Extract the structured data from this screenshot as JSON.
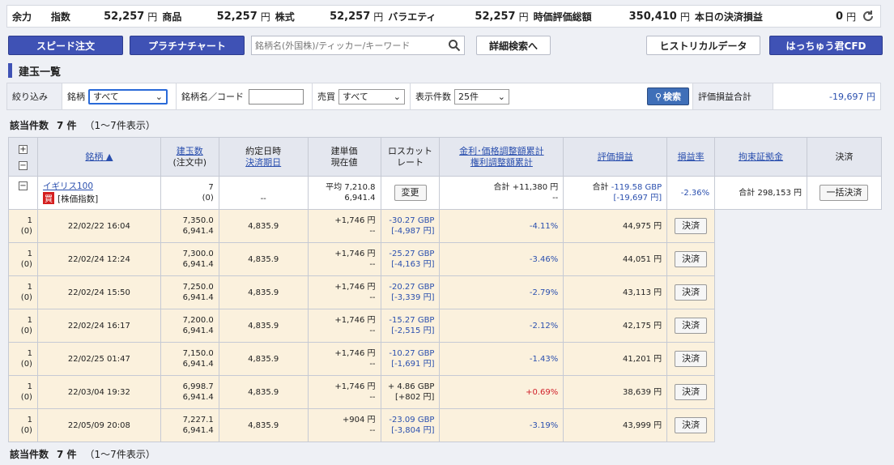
{
  "topbar": {
    "yoryoku": "余力",
    "index_label": "指数",
    "index_value": "52,257",
    "commodity_label": "商品",
    "commodity_value": "52,257",
    "stock_label": "株式",
    "stock_value": "52,257",
    "variety_label": "バラエティ",
    "variety_value": "52,257",
    "valuation_label": "時価評価総額",
    "valuation_value": "350,410",
    "settle_label": "本日の決済損益",
    "settle_value": "0",
    "yen": "円"
  },
  "buttons": {
    "speed_order": "スピード注文",
    "platinum_chart": "プラチナチャート",
    "search_placeholder": "銘柄名(外国株)/ティッカー/キーワード",
    "detail_search": "詳細検索へ",
    "historical": "ヒストリカルデータ",
    "hacchu": "はっちゅう君CFD"
  },
  "section_title": "建玉一覧",
  "filter": {
    "narrow": "絞り込み",
    "brand_label": "銘柄",
    "brand_value": "すべて",
    "name_code_label": "銘柄名／コード",
    "buysell_label": "売買",
    "buysell_value": "すべて",
    "count_label": "表示件数",
    "count_value": "25件",
    "search_btn": "検索",
    "pl_total_label": "評価損益合計",
    "pl_total_value": "-19,697 円"
  },
  "summary": {
    "label": "該当件数",
    "count": "7 件",
    "range": "（1〜7件表示）"
  },
  "headers": {
    "brand": "銘柄 ▲",
    "position_qty": "建玉数",
    "in_order": "(注文中)",
    "contract_date": "約定日時",
    "settle_date": "決済期日",
    "build_price": "建単価",
    "current_price": "現在値",
    "losscut": "ロスカット",
    "rate": "レート",
    "interest": "金利･価格調整額累計",
    "rights": "権利調整額累計",
    "valuation": "評価損益",
    "pl_rate": "損益率",
    "margin": "拘束証拠金",
    "settlement": "決済"
  },
  "main_row": {
    "brand_name": "イギリス100",
    "buy_badge": "買",
    "brand_type": "[株価指数]",
    "qty": "7",
    "qty_order": "(0)",
    "date": "--",
    "avg_label": "平均",
    "build": "7,210.8",
    "current": "6,941.4",
    "change_btn": "変更",
    "interest_label": "合計",
    "interest": "+11,380 円",
    "rights": "--",
    "val_label": "合計",
    "val_gbp": "-119.58 GBP",
    "val_jpy": "[-19,697 円]",
    "rate": "-2.36%",
    "margin_label": "合計",
    "margin": "298,153 円",
    "bulk_btn": "一括決済"
  },
  "rows": [
    {
      "qty": "1",
      "order": "(0)",
      "date": "22/02/22 16:04",
      "build": "7,350.0",
      "current": "6,941.4",
      "losscut": "4,835.9",
      "interest": "+1,746 円",
      "rights": "--",
      "gbp": "-30.27 GBP",
      "jpy": "[-4,987 円]",
      "rate": "-4.11%",
      "margin": "44,975 円",
      "btn": "決済",
      "sign": "neg"
    },
    {
      "qty": "1",
      "order": "(0)",
      "date": "22/02/24 12:24",
      "build": "7,300.0",
      "current": "6,941.4",
      "losscut": "4,835.9",
      "interest": "+1,746 円",
      "rights": "--",
      "gbp": "-25.27 GBP",
      "jpy": "[-4,163 円]",
      "rate": "-3.46%",
      "margin": "44,051 円",
      "btn": "決済",
      "sign": "neg"
    },
    {
      "qty": "1",
      "order": "(0)",
      "date": "22/02/24 15:50",
      "build": "7,250.0",
      "current": "6,941.4",
      "losscut": "4,835.9",
      "interest": "+1,746 円",
      "rights": "--",
      "gbp": "-20.27 GBP",
      "jpy": "[-3,339 円]",
      "rate": "-2.79%",
      "margin": "43,113 円",
      "btn": "決済",
      "sign": "neg"
    },
    {
      "qty": "1",
      "order": "(0)",
      "date": "22/02/24 16:17",
      "build": "7,200.0",
      "current": "6,941.4",
      "losscut": "4,835.9",
      "interest": "+1,746 円",
      "rights": "--",
      "gbp": "-15.27 GBP",
      "jpy": "[-2,515 円]",
      "rate": "-2.12%",
      "margin": "42,175 円",
      "btn": "決済",
      "sign": "neg"
    },
    {
      "qty": "1",
      "order": "(0)",
      "date": "22/02/25 01:47",
      "build": "7,150.0",
      "current": "6,941.4",
      "losscut": "4,835.9",
      "interest": "+1,746 円",
      "rights": "--",
      "gbp": "-10.27 GBP",
      "jpy": "[-1,691 円]",
      "rate": "-1.43%",
      "margin": "41,201 円",
      "btn": "決済",
      "sign": "neg"
    },
    {
      "qty": "1",
      "order": "(0)",
      "date": "22/03/04 19:32",
      "build": "6,998.7",
      "current": "6,941.4",
      "losscut": "4,835.9",
      "interest": "+1,746 円",
      "rights": "--",
      "gbp": "+ 4.86 GBP",
      "jpy": "[+802 円]",
      "rate": "+0.69%",
      "margin": "38,639 円",
      "btn": "決済",
      "sign": "pos"
    },
    {
      "qty": "1",
      "order": "(0)",
      "date": "22/05/09 20:08",
      "build": "7,227.1",
      "current": "6,941.4",
      "losscut": "4,835.9",
      "interest": "+904 円",
      "rights": "--",
      "gbp": "-23.09 GBP",
      "jpy": "[-3,804 円]",
      "rate": "-3.19%",
      "margin": "43,999 円",
      "btn": "決済",
      "sign": "neg"
    }
  ],
  "colors": {
    "accent": "#3f52b5",
    "negative": "#2a4fae",
    "positive": "#d0202a",
    "row_bg": "#fbf1dd"
  }
}
